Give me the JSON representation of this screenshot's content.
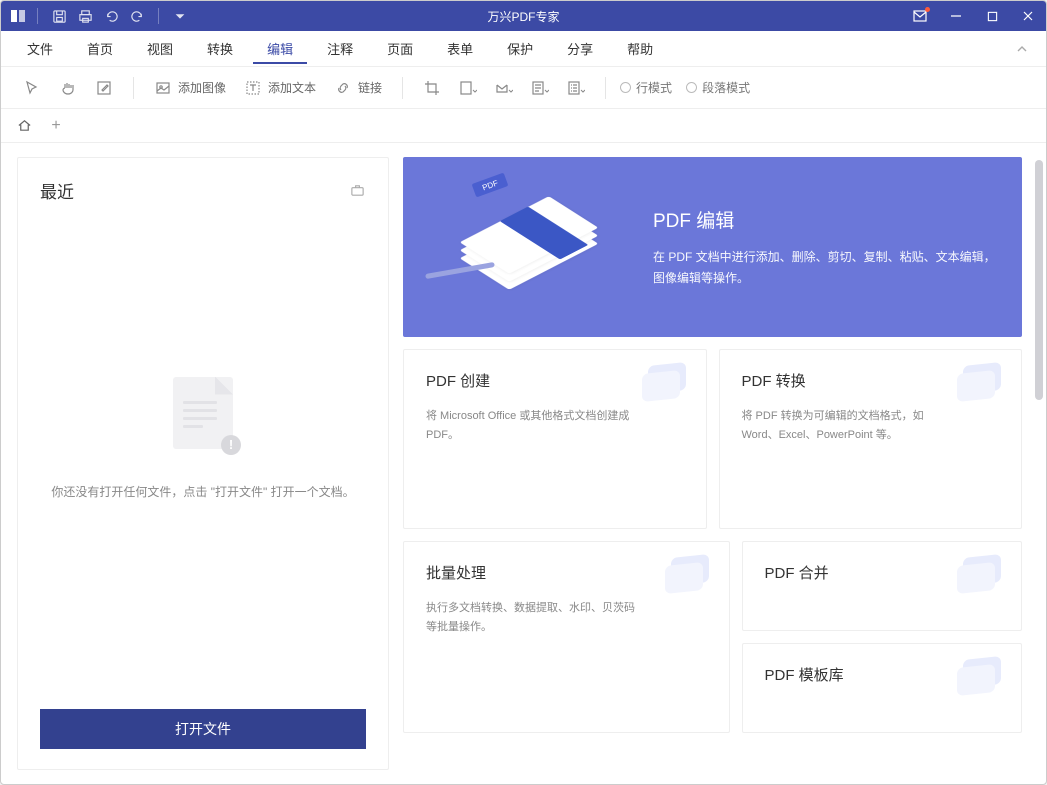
{
  "titlebar": {
    "title": "万兴PDF专家"
  },
  "menu": {
    "items": [
      "文件",
      "首页",
      "视图",
      "转换",
      "编辑",
      "注释",
      "页面",
      "表单",
      "保护",
      "分享",
      "帮助"
    ],
    "active_index": 4
  },
  "toolbar": {
    "add_image": "添加图像",
    "add_text": "添加文本",
    "link": "链接",
    "mode_line": "行模式",
    "mode_paragraph": "段落模式"
  },
  "recent": {
    "title": "最近",
    "empty_text": "你还没有打开任何文件，点击 \"打开文件\" 打开一个文档。",
    "open_button": "打开文件"
  },
  "hero": {
    "title": "PDF 编辑",
    "desc": "在 PDF 文档中进行添加、删除、剪切、复制、粘贴、文本编辑，图像编辑等操作。",
    "pdf_label": "PDF"
  },
  "cards": {
    "create": {
      "title": "PDF 创建",
      "desc": "将 Microsoft Office 或其他格式文档创建成 PDF。"
    },
    "convert": {
      "title": "PDF 转换",
      "desc": "将 PDF 转换为可编辑的文档格式，如 Word、Excel、PowerPoint 等。"
    },
    "batch": {
      "title": "批量处理",
      "desc": "执行多文档转换、数据提取、水印、贝茨码等批量操作。"
    },
    "merge": {
      "title": "PDF 合并"
    },
    "template": {
      "title": "PDF 模板库"
    }
  }
}
